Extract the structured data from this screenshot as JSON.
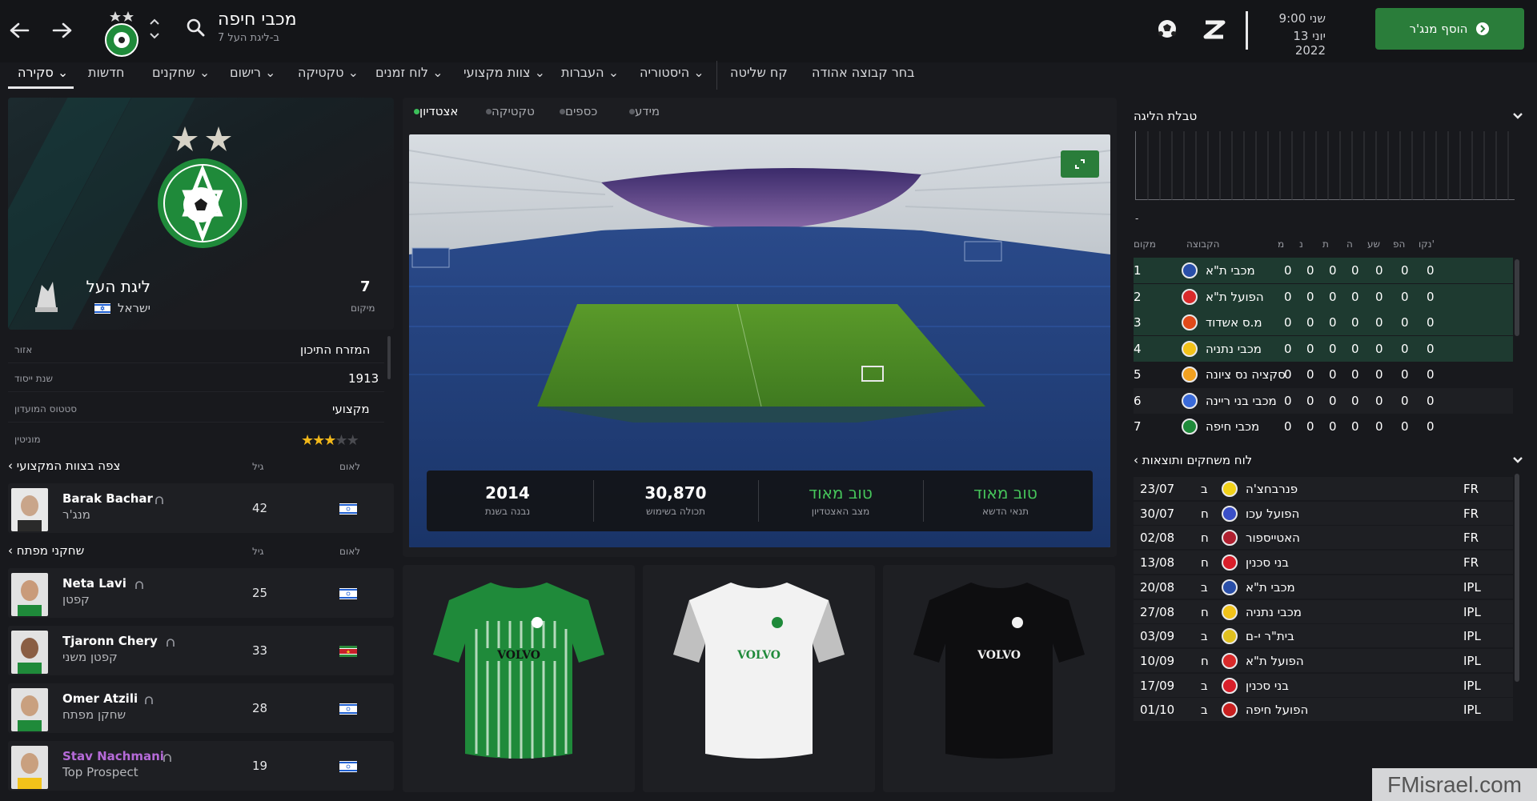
{
  "header": {
    "club_title": "מכבי חיפה",
    "club_subtitle": "7 ב-ליגת העל",
    "time": "שני 9:00",
    "date": "13 יוני 2022",
    "add_manager": "הוסף מנג'ר"
  },
  "menu": {
    "overview": "סקירה",
    "news": "חדשות",
    "players": "שחקנים",
    "recruitment": "רישום",
    "tactics": "טקטיקה",
    "schedule": "לוח זמנים",
    "staff": "צוות מקצועי",
    "transfers": "העברות",
    "history": "היסטוריה",
    "take_control": "קח שליטה",
    "choose_favorite": "בחר קבוצה אהודה"
  },
  "club_card": {
    "league": "ליגת העל",
    "country": "ישראל",
    "rank": "7",
    "rank_label": "מיקום"
  },
  "club_info": [
    {
      "label": "אזור",
      "value": "המזרח התיכון"
    },
    {
      "label": "שנת ייסוד",
      "value": "1913"
    },
    {
      "label": "סטטוס המועדון",
      "value": "מקצועי"
    },
    {
      "label": "מוניטין",
      "value": "",
      "stars": 3
    }
  ],
  "staff_section": {
    "title": "צפה בצוות המקצועי",
    "col_age": "גיל",
    "col_nation": "לאום",
    "people": [
      {
        "name": "Barak Bachar",
        "role": "מנג'ר",
        "age": "42"
      }
    ]
  },
  "key_players": {
    "title": "שחקני מפתח",
    "col_age": "גיל",
    "col_nation": "לאום",
    "people": [
      {
        "name": "Neta Lavi",
        "role": "קפטן",
        "age": "25"
      },
      {
        "name": "Tjaronn Chery",
        "role": "קפטן משני",
        "age": "33"
      },
      {
        "name": "Omer Atzili",
        "role": "שחקן מפתח",
        "age": "28"
      },
      {
        "name": "Stav Nachmani",
        "role": "Top Prospect",
        "age": "19"
      }
    ]
  },
  "center_tabs": {
    "stadium": "אצטדיון",
    "tactic": "טקטיקה",
    "finances": "כספים",
    "info": "מידע"
  },
  "stadium_stats": [
    {
      "value": "2014",
      "label": "נבנה בשנת"
    },
    {
      "value": "30,870",
      "label": "תכולה בשימוש"
    },
    {
      "value": "טוב מאוד",
      "label": "מצב האצטדיון"
    },
    {
      "value": "טוב מאוד",
      "label": "תנאי הדשא"
    }
  ],
  "kits": {
    "sponsor": "VOLVO"
  },
  "league_table": {
    "title": "טבלת הליגה",
    "dash": "-",
    "headers": {
      "pos": "מקום",
      "team": "הקבוצה",
      "p": "מ",
      "w": "נ",
      "d": "ת",
      "l": "ה",
      "gf": "שע",
      "ga": "הפ",
      "pts": "נקו'"
    },
    "rows": [
      {
        "pos": "1",
        "team": "מכבי ת\"א",
        "p": "0",
        "w": "0",
        "d": "0",
        "l": "0",
        "gf": "0",
        "ga": "0",
        "pts": "0",
        "color": "#2a4fa8"
      },
      {
        "pos": "2",
        "team": "הפועל ת\"א",
        "p": "0",
        "w": "0",
        "d": "0",
        "l": "0",
        "gf": "0",
        "ga": "0",
        "pts": "0",
        "color": "#d92a2a"
      },
      {
        "pos": "3",
        "team": "מ.ס אשדוד",
        "p": "0",
        "w": "0",
        "d": "0",
        "l": "0",
        "gf": "0",
        "ga": "0",
        "pts": "0",
        "color": "#e04a1a"
      },
      {
        "pos": "4",
        "team": "מכבי נתניה",
        "p": "0",
        "w": "0",
        "d": "0",
        "l": "0",
        "gf": "0",
        "ga": "0",
        "pts": "0",
        "color": "#f2c31a"
      },
      {
        "pos": "5",
        "team": "סקציה נס ציונה",
        "p": "0",
        "w": "0",
        "d": "0",
        "l": "0",
        "gf": "0",
        "ga": "0",
        "pts": "0",
        "color": "#f0a020"
      },
      {
        "pos": "6",
        "team": "מכבי בני ריינה",
        "p": "0",
        "w": "0",
        "d": "0",
        "l": "0",
        "gf": "0",
        "ga": "0",
        "pts": "0",
        "color": "#3a6ad8"
      },
      {
        "pos": "7",
        "team": "מכבי חיפה",
        "p": "0",
        "w": "0",
        "d": "0",
        "l": "0",
        "gf": "0",
        "ga": "0",
        "pts": "0",
        "color": "#1f8a3a"
      }
    ]
  },
  "fixtures": {
    "title": "לוח משחקים ותוצאות",
    "rows": [
      {
        "date": "23/07",
        "venue": "ב",
        "team": "פנרבחצ'ה",
        "comp": "FR",
        "color": "#f2d21a"
      },
      {
        "date": "30/07",
        "venue": "ח",
        "team": "הפועל עכו",
        "comp": "FR",
        "color": "#3a4fc8"
      },
      {
        "date": "02/08",
        "venue": "ח",
        "team": "האטייספור",
        "comp": "FR",
        "color": "#b02030"
      },
      {
        "date": "13/08",
        "venue": "ח",
        "team": "בני סכנין",
        "comp": "FR",
        "color": "#d81f2a"
      },
      {
        "date": "20/08",
        "venue": "ב",
        "team": "מכבי ת\"א",
        "comp": "IPL",
        "color": "#2a4fa8"
      },
      {
        "date": "27/08",
        "venue": "ח",
        "team": "מכבי נתניה",
        "comp": "IPL",
        "color": "#f2c31a"
      },
      {
        "date": "03/09",
        "venue": "ב",
        "team": "בית\"ר י-ם",
        "comp": "IPL",
        "color": "#e0c020"
      },
      {
        "date": "10/09",
        "venue": "ח",
        "team": "הפועל ת\"א",
        "comp": "IPL",
        "color": "#d92a2a"
      },
      {
        "date": "17/09",
        "venue": "ב",
        "team": "בני סכנין",
        "comp": "IPL",
        "color": "#d81f2a"
      },
      {
        "date": "01/10",
        "venue": "ב",
        "team": "הפועל חיפה",
        "comp": "IPL",
        "color": "#c82020"
      }
    ]
  },
  "watermark": "FMisrael.com"
}
